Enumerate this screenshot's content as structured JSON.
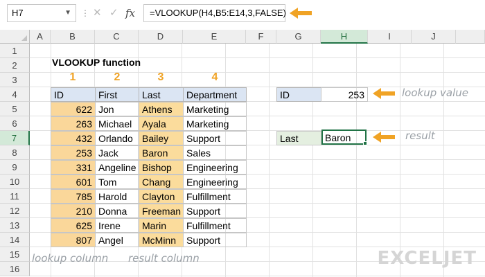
{
  "formula_bar": {
    "name_box": "H7",
    "formula": "=VLOOKUP(H4,B5:E14,3,FALSE)",
    "fx_label": "fx"
  },
  "columns": [
    "A",
    "B",
    "C",
    "D",
    "E",
    "F",
    "G",
    "H",
    "I",
    "J"
  ],
  "rows": [
    "1",
    "2",
    "3",
    "4",
    "5",
    "6",
    "7",
    "8",
    "9",
    "10",
    "11",
    "12",
    "13",
    "14",
    "15",
    "16"
  ],
  "sheet": {
    "title": "VLOOKUP function",
    "markers": [
      "1",
      "2",
      "3",
      "4"
    ],
    "headers": [
      "ID",
      "First",
      "Last",
      "Department"
    ],
    "data": [
      [
        "622",
        "Jon",
        "Athens",
        "Marketing"
      ],
      [
        "263",
        "Michael",
        "Ayala",
        "Marketing"
      ],
      [
        "432",
        "Orlando",
        "Bailey",
        "Support"
      ],
      [
        "253",
        "Jack",
        "Baron",
        "Sales"
      ],
      [
        "331",
        "Angeline",
        "Bishop",
        "Engineering"
      ],
      [
        "601",
        "Tom",
        "Chang",
        "Engineering"
      ],
      [
        "785",
        "Harold",
        "Clayton",
        "Fulfillment"
      ],
      [
        "210",
        "Donna",
        "Freeman",
        "Support"
      ],
      [
        "625",
        "Irene",
        "Marin",
        "Fulfillment"
      ],
      [
        "807",
        "Angel",
        "McMinn",
        "Support"
      ]
    ],
    "lookup_label": "ID",
    "lookup_value": "253",
    "result_label": "Last",
    "result_value": "Baron"
  },
  "annotations": {
    "lookup_value": "lookup value",
    "result": "result",
    "lookup_column": "lookup column",
    "result_column": "result column"
  },
  "logo": "EXCELJET",
  "colors": {
    "header_fill": "#dbe5f3",
    "orange_fill": "#fbdc9c",
    "arrow": "#f0a325",
    "selection": "#217346"
  }
}
